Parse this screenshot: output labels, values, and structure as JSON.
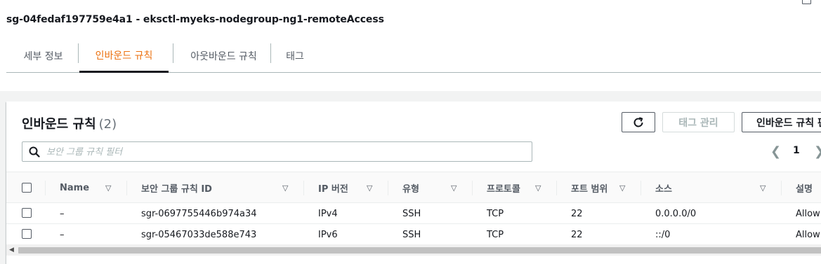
{
  "header": {
    "title": "sg-04fedaf197759e4a1 - eksctl-myeks-nodegroup-ng1-remoteAccess"
  },
  "tabs": [
    {
      "label": "세부 정보",
      "active": false
    },
    {
      "label": "인바운드 규칙",
      "active": true
    },
    {
      "label": "아웃바운드 규칙",
      "active": false
    },
    {
      "label": "태그",
      "active": false
    }
  ],
  "panel": {
    "title": "인바운드 규칙",
    "count": "(2)",
    "buttons": {
      "refresh_icon": "refresh-icon",
      "manage_tags": "태그 관리",
      "edit_inbound": "인바운드 규칙 편집"
    },
    "search": {
      "placeholder": "보안 그룹 규칙 필터",
      "value": ""
    },
    "pagination": {
      "current_page": "1"
    }
  },
  "table": {
    "columns": [
      "Name",
      "보안 그룹 규칙 ID",
      "IP 버전",
      "유형",
      "프로토콜",
      "포트 범위",
      "소스",
      "설명"
    ],
    "rows": [
      {
        "name": "–",
        "rule_id": "sgr-0697755446b974a34",
        "ip_version": "IPv4",
        "type": "SSH",
        "protocol": "TCP",
        "port_range": "22",
        "source": "0.0.0.0/0",
        "description": "Allow"
      },
      {
        "name": "–",
        "rule_id": "sgr-05467033de588e743",
        "ip_version": "IPv6",
        "type": "SSH",
        "protocol": "TCP",
        "port_range": "22",
        "source": "::/0",
        "description": "Allow"
      }
    ]
  },
  "colors": {
    "accent_tab": "#ec7211",
    "text": "#16191f",
    "muted": "#545b64"
  }
}
